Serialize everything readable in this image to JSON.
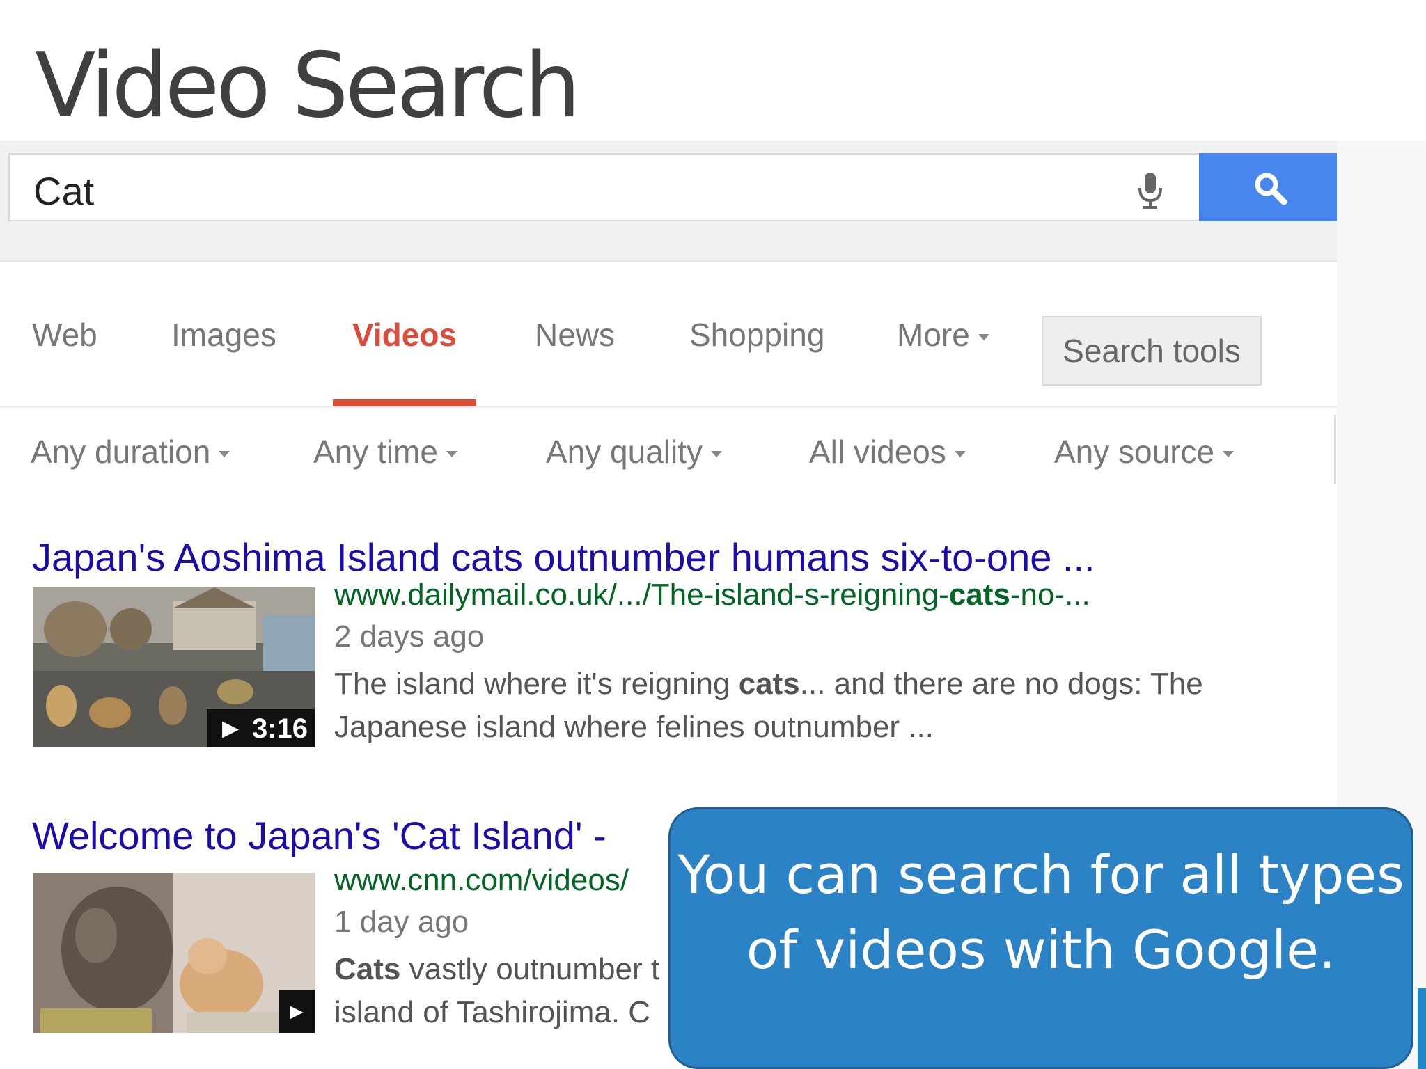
{
  "slide": {
    "title": "Video Search",
    "callout": "You can search for all types of videos with Google."
  },
  "search": {
    "query": "Cat"
  },
  "tabs": [
    {
      "label": "Web",
      "active": false
    },
    {
      "label": "Images",
      "active": false
    },
    {
      "label": "Videos",
      "active": true
    },
    {
      "label": "News",
      "active": false
    },
    {
      "label": "Shopping",
      "active": false
    },
    {
      "label": "More",
      "active": false
    }
  ],
  "search_tools_label": "Search tools",
  "filters": [
    "Any duration",
    "Any time",
    "Any quality",
    "All videos",
    "Any source"
  ],
  "results": [
    {
      "title": "Japan's Aoshima Island cats outnumber humans six-to-one ...",
      "url_prefix": "www.dailymail.co.uk/.../The-island-s-reigning-",
      "url_bold": "cats",
      "url_suffix": "-no-...",
      "date": "2 days ago",
      "snippet_1a": "The island where it's reigning ",
      "snippet_1b": "cats",
      "snippet_1c": "... and there are no dogs: The",
      "snippet_2": "Japanese island where felines outnumber ...",
      "duration": "► 3:16"
    },
    {
      "title": "Welcome to Japan's 'Cat Island' -",
      "url": "www.cnn.com/videos/",
      "date": "1 day ago",
      "snippet_1a": "Cats",
      "snippet_1b": " vastly outnumber t",
      "snippet_2": "island of Tashirojima. C",
      "play": "►"
    }
  ],
  "colors": {
    "link": "#1a0dab",
    "url": "#006621",
    "active_tab": "#dd4b39",
    "search_button": "#4787ed",
    "callout": "#2b82c5"
  }
}
